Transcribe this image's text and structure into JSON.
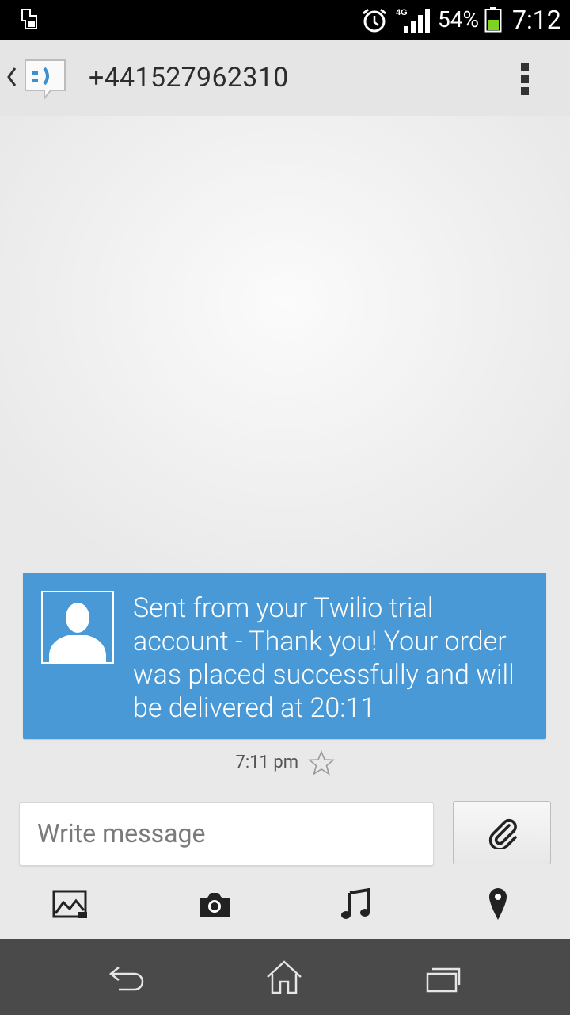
{
  "status_bar": {
    "network_type": "4G",
    "battery_percent": "54%",
    "battery_level": 0.54,
    "time": "7:12",
    "icons": [
      "sd-card-icon",
      "alarm-icon",
      "signal-icon",
      "battery-icon"
    ]
  },
  "header": {
    "title": "+441527962310",
    "icons": [
      "back-chevron-icon",
      "messaging-app-icon",
      "overflow-menu-icon"
    ]
  },
  "conversation": {
    "messages": [
      {
        "text": "Sent from your Twilio trial account - Thank you! Your order was placed successfully and will be delivered at 20:11",
        "time": "7:11 pm",
        "starred": false,
        "bubble_color": "#4899d6"
      }
    ]
  },
  "composer": {
    "placeholder": "Write message",
    "attach_icon": "paperclip-icon"
  },
  "media_bar": {
    "icons": [
      "gallery-icon",
      "camera-icon",
      "music-icon",
      "location-icon"
    ]
  },
  "nav_bar": {
    "icons": [
      "back-icon",
      "home-icon",
      "recents-icon"
    ]
  },
  "colors": {
    "accent": "#4899d6",
    "status_bar": "#000000",
    "nav_bar": "#4a4a4a"
  }
}
